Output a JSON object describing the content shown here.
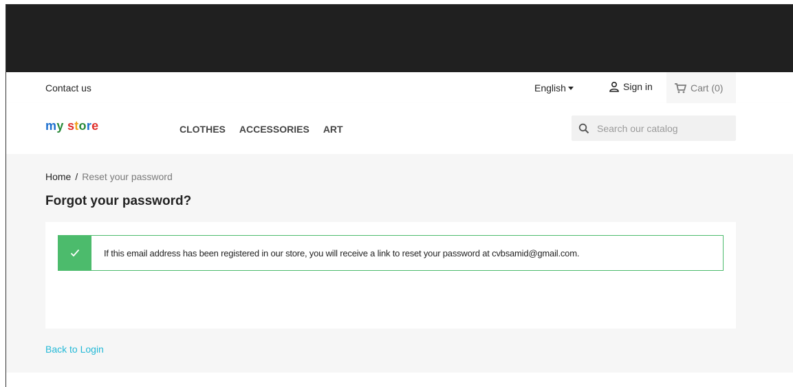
{
  "nav": {
    "contact": "Contact us",
    "language": "English",
    "signin": "Sign in",
    "cart": "Cart (0)"
  },
  "header": {
    "logo": "my store",
    "menu": [
      "CLOTHES",
      "ACCESSORIES",
      "ART"
    ],
    "search_placeholder": "Search our catalog"
  },
  "breadcrumb": {
    "home": "Home",
    "separator": "/",
    "current": "Reset your password"
  },
  "page": {
    "title": "Forgot your password?",
    "alert_message": "If this email address has been registered in our store, you will receive a link to reset your password at cvbsamid@gmail.com.",
    "back_link": "Back to Login"
  },
  "colors": {
    "topbar": "#202020",
    "success": "#4cbb6c",
    "link": "#24b9d7"
  },
  "icons": [
    "user-icon",
    "cart-icon",
    "search-icon",
    "check-icon",
    "caret-down-icon"
  ]
}
